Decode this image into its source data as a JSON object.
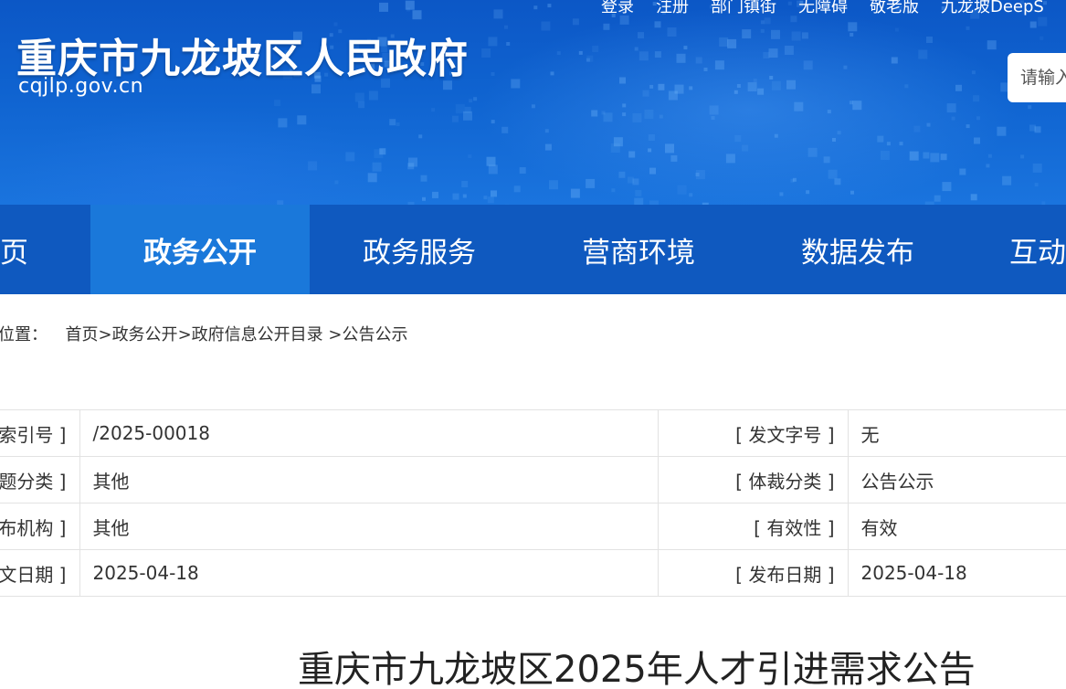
{
  "header": {
    "site_name": "重庆市九龙坡区人民政府",
    "site_domain": "cqjlp.gov.cn",
    "top_links": [
      "登录",
      "注册",
      "部门镇街",
      "无障碍",
      "敬老版",
      "九龙坡DeepS"
    ],
    "search_placeholder": "请输入"
  },
  "nav": {
    "items": [
      "页",
      "政务公开",
      "政务服务",
      "营商环境",
      "数据发布",
      "互动"
    ],
    "active": "政务公开"
  },
  "breadcrumb": {
    "prefix": "位置：",
    "items": [
      "首页",
      "政务公开",
      "政府信息公开目录",
      "公告公示"
    ],
    "separator": ">"
  },
  "info_table": {
    "rows": [
      {
        "label1": "索引号 ]",
        "value1": "/2025-00018",
        "label2": "[ 发文字号 ]",
        "value2": "无"
      },
      {
        "label1": "题分类 ]",
        "value1": "其他",
        "label2": "[ 体裁分类 ]",
        "value2": "公告公示"
      },
      {
        "label1": "布机构 ]",
        "value1": "其他",
        "label2": "[ 有效性 ]",
        "value2": "有效"
      },
      {
        "label1": "文日期 ]",
        "value1": "2025-04-18",
        "label2": "[ 发布日期 ]",
        "value2": "2025-04-18"
      }
    ]
  },
  "article": {
    "title": "重庆市九龙坡区2025年人才引进需求公告"
  },
  "colors": {
    "banner": "#0f63d0",
    "nav": "#0f59bf",
    "nav_active": "#1a78da",
    "border": "#e2e2e2"
  }
}
